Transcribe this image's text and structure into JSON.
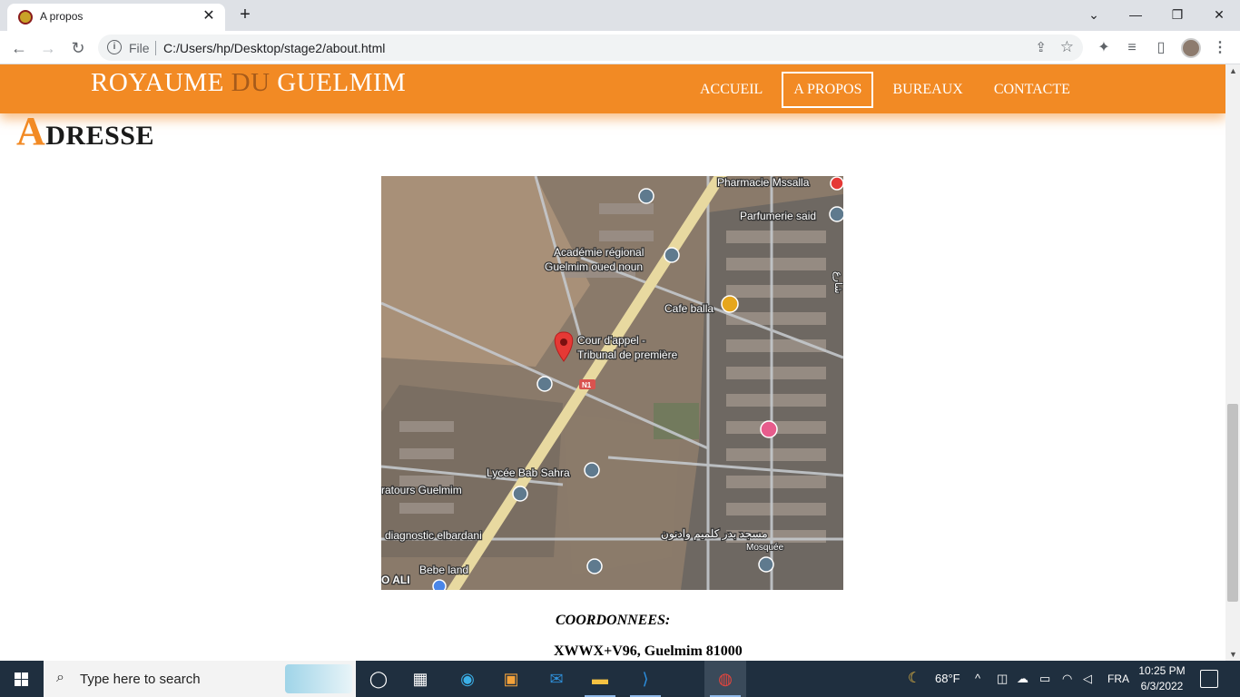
{
  "browser": {
    "tab_title": "A propos",
    "tab_close": "✕",
    "new_tab": "+",
    "window_buttons": {
      "dropdown": "⌄",
      "minimize": "—",
      "restore": "❐",
      "close": "✕"
    },
    "nav": {
      "back": "←",
      "forward": "→",
      "reload": "↻"
    },
    "omnibox": {
      "scheme_label": "File",
      "url": "C:/Users/hp/Desktop/stage2/about.html"
    },
    "icons": [
      "info-icon",
      "share-icon",
      "star-icon",
      "extensions-icon",
      "media-icon",
      "sidepanel-icon",
      "profile-avatar",
      "menu-icon"
    ]
  },
  "site": {
    "brand": {
      "part1": "ROYAUME ",
      "part2": "DU",
      "part3": " GUELMIM"
    },
    "nav": [
      {
        "label": "ACCUEIL",
        "active": false
      },
      {
        "label": "A PROPOS",
        "active": true
      },
      {
        "label": "BUREAUX",
        "active": false
      },
      {
        "label": "CONTACTE",
        "active": false
      }
    ],
    "section": {
      "cap": "A",
      "rest": "DRESSE"
    },
    "map": {
      "labels": {
        "pharmacie": "Pharmacie Mssalla",
        "parfumerie": "Parfumerie said",
        "academie_1": "Académie régional",
        "academie_2": "Guelmim oued noun",
        "cafe": "Cafe balla",
        "cour_1": "Cour d'appel -",
        "cour_2": "Tribunal de première",
        "road": "N1",
        "lycee": "Lycée Bab Sahra",
        "ratours": "ratours Guelmim",
        "diagnostic": "diagnostic elbardani",
        "mosque_ar": "مسجد بدر كلميم وادنون",
        "mosque": "Mosquée",
        "bebe": "Bebe land",
        "oali": "O ALI",
        "edge_ar": "شارع"
      }
    },
    "coords_label": "COORDONNEES:",
    "coords_value": "XWWX+V96, Guelmim 81000"
  },
  "taskbar": {
    "search_placeholder": "Type here to search",
    "weather": "68°F",
    "language": "FRA",
    "time": "10:25 PM",
    "date": "6/3/2022",
    "apps": [
      "task-view-icon",
      "widgets-icon",
      "edge-icon",
      "store-icon",
      "mail-icon",
      "file-explorer-icon",
      "vscode-icon",
      "chrome-icon"
    ]
  }
}
